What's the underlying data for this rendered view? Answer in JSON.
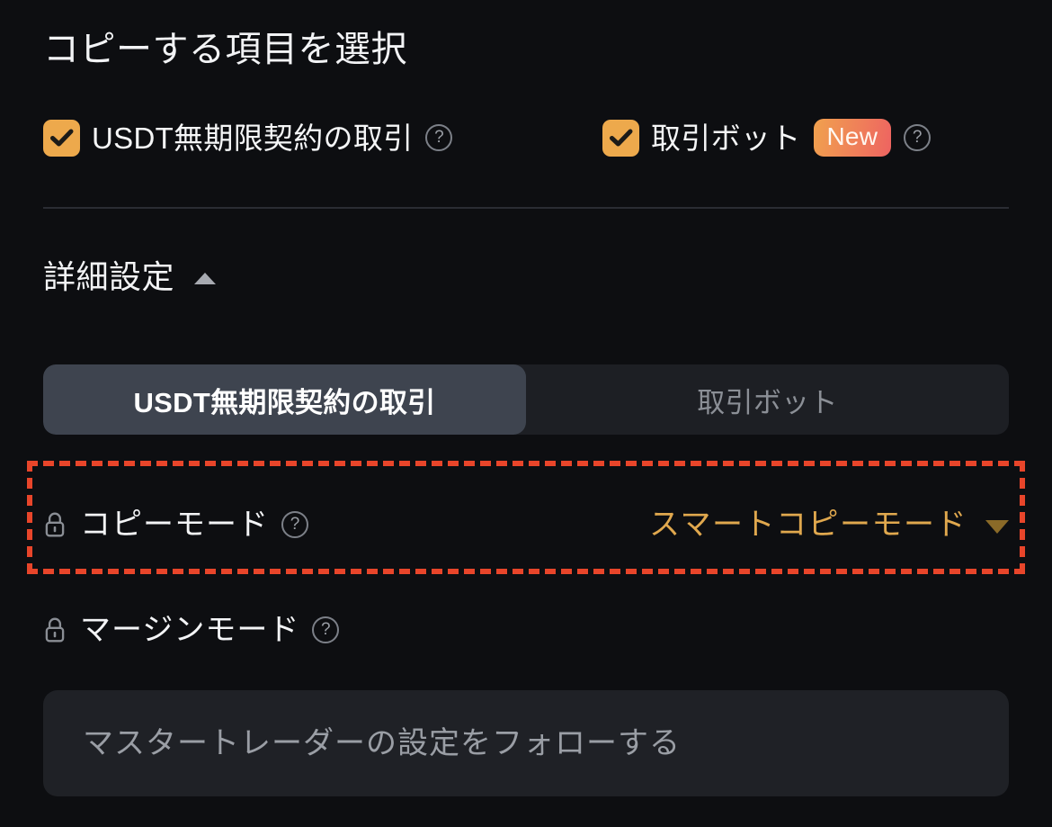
{
  "panel": {
    "section_title": "コピーする項目を選択"
  },
  "copy_items": {
    "options": [
      {
        "label": "USDT無期限契約の取引",
        "checked": true,
        "help_icon": "question-circle-icon",
        "badge": ""
      },
      {
        "label": "取引ボット",
        "checked": true,
        "help_icon": "question-circle-icon",
        "badge": "New"
      }
    ]
  },
  "advanced": {
    "label": "詳細設定",
    "caret_icon": "chevron-up-icon",
    "expanded": true,
    "tabs": [
      {
        "label": "USDT無期限契約の取引",
        "active": true
      },
      {
        "label": "取引ボット",
        "active": false
      }
    ],
    "settings": [
      {
        "label": "コピーモード",
        "lock_icon": "lock-icon",
        "help_icon": "question-circle-icon",
        "value": "スマートコピーモード",
        "caret_icon": "chevron-down-icon",
        "highlighted": true
      },
      {
        "label": "マージンモード",
        "lock_icon": "lock-icon",
        "help_icon": "question-circle-icon",
        "value": "",
        "caret_icon": "",
        "highlighted": false
      }
    ],
    "margin_mode_input": {
      "placeholder": "マスタートレーダーの設定をフォローする",
      "value": ""
    }
  },
  "colors": {
    "background": "#0d0e11",
    "accent_amber": "#eda94c",
    "value_amber": "#e0a84e",
    "highlight_dashed": "#e8452a",
    "tab_active_bg": "#3e444f",
    "tab_track_bg": "#1d1f24",
    "input_bg": "#1f2126",
    "badge_gradient_start": "#f0a14e",
    "badge_gradient_end": "#ee6361"
  }
}
